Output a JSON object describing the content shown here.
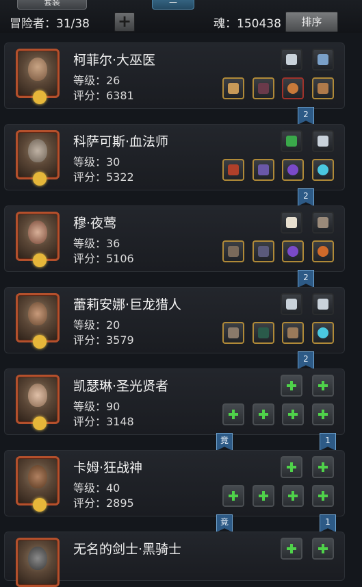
{
  "tabs": [
    "套装",
    "—"
  ],
  "header": {
    "adventurers_label": "冒险者：31/38",
    "soul_label": "魂：150438",
    "sort_label": "排序",
    "add_symbol": "+"
  },
  "heroes": [
    {
      "name": "柯菲尔·大巫医",
      "level": "等级：26",
      "score": "评分：6381",
      "badge": "2"
    },
    {
      "name": "科萨可斯·血法师",
      "level": "等级：30",
      "score": "评分：5322",
      "badge": "2"
    },
    {
      "name": "穆·夜莺",
      "level": "等级：36",
      "score": "评分：5106",
      "badge": "2"
    },
    {
      "name": "蕾莉安娜·巨龙猎人",
      "level": "等级：20",
      "score": "评分：3579",
      "badge": "2"
    },
    {
      "name": "凯瑟琳·圣光贤者",
      "level": "等级：90",
      "score": "评分：3148",
      "badge_left": "竟",
      "badge": "1"
    },
    {
      "name": "卡姆·狂战神",
      "level": "等级：40",
      "score": "评分：2895",
      "badge_left": "竟",
      "badge": "1"
    },
    {
      "name": "无名的剑士·黑骑士",
      "level": "",
      "score": "",
      "badge": ""
    }
  ],
  "colors": {
    "frame_red": "#b4502c",
    "slot_gold": "#b08a38",
    "plus_green": "#4fd24a",
    "ribbon_blue": "#2d5a86"
  }
}
